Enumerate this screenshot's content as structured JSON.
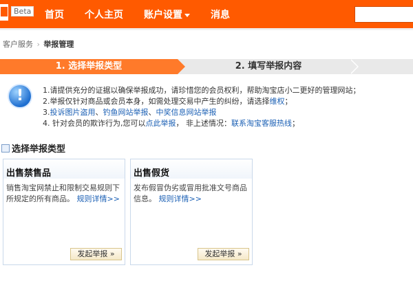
{
  "header": {
    "beta": "Beta",
    "nav": [
      {
        "label": "首页"
      },
      {
        "label": "个人主页"
      },
      {
        "label": "账户设置"
      },
      {
        "label": "消息"
      }
    ],
    "search_value": ""
  },
  "breadcrumb": {
    "root": "客户服务",
    "sep": "›",
    "current": "举报管理"
  },
  "steps": {
    "step1": "1. 选择举报类型",
    "step2": "2. 填写举报内容"
  },
  "notice": {
    "line1": "1.请提供充分的证据以确保举报成功，请珍惜您的会员权利，帮助淘宝店小二更好的管理网站；",
    "line2_text": "2.举报仅针对商品或会员本身，如需处理交易中产生的纠纷，请选择",
    "line2_link": "维权",
    "line2_end": "；",
    "line3_prefix": "3.",
    "line3_link1": "投诉图片盗用",
    "line3_sep1": "、",
    "line3_link2": "钓鱼网站举报",
    "line3_sep2": "、",
    "line3_link3": "中奖信息网站举报",
    "line4_text": "4. 针对会员的欺诈行为,您可以",
    "line4_link1": "点此举报",
    "line4_mid": "， 非上述情况：",
    "line4_link2": "联系淘宝客服热线",
    "line4_end": "；"
  },
  "section": {
    "title": "选择举报类型"
  },
  "cards": [
    {
      "title": "出售禁售品",
      "desc": "销售淘宝网禁止和限制交易规则下所规定的所有商品。",
      "link": "规则详情>>",
      "button": "发起举报 »"
    },
    {
      "title": "出售假货",
      "desc": "发布假冒伪劣或冒用批准文号商品信息。",
      "link": "规则详情>>",
      "button": "发起举报 »"
    }
  ],
  "colors": {
    "brand": "#ff5a00",
    "step_active": "#ff7a2a",
    "link": "#1a5fb4"
  }
}
